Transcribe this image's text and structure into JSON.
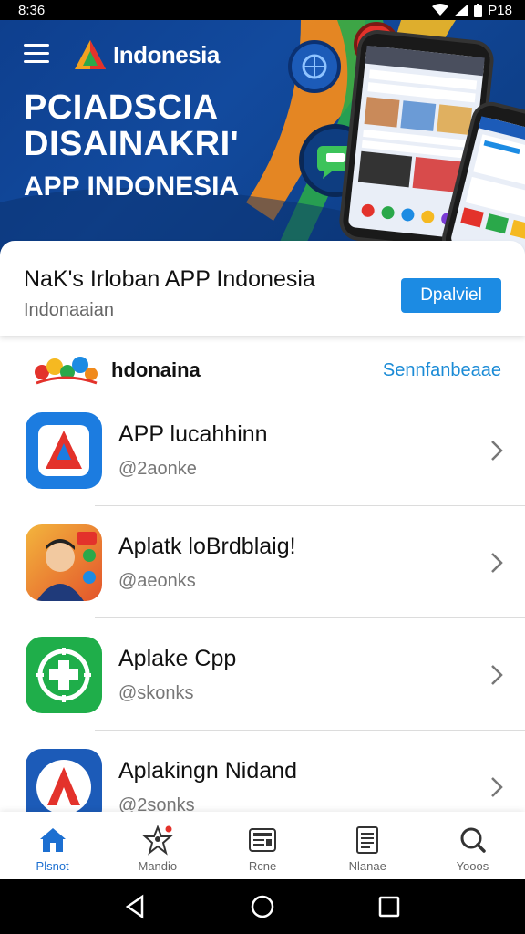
{
  "status_bar": {
    "time": "8:36",
    "battery": "P18"
  },
  "hero": {
    "brand_name": "Indonesia",
    "title_line1": "PCIADSCIA",
    "title_line2": "DISAINAKRI'",
    "subtitle": "APP INDONESIA"
  },
  "feature": {
    "title": "NaK's Irloban APP Indonesia",
    "subtitle": "Indonaaian",
    "button_label": "Dpalviel"
  },
  "section": {
    "title": "hdonaina",
    "link": "Sennfanbeaae"
  },
  "apps": [
    {
      "name": "APP lucahhinn",
      "handle": "@2aonke",
      "icon": "red-arrow-icon"
    },
    {
      "name": "Aplatk loBrdblaig!",
      "handle": "@aeonks",
      "icon": "person-photo-icon"
    },
    {
      "name": "Aplake Cpp",
      "handle": "@skonks",
      "icon": "green-cross-icon"
    },
    {
      "name": "Aplakingn Nidand",
      "handle": "@2sonks",
      "icon": "red-a-icon"
    }
  ],
  "bottom_nav": [
    {
      "label": "Plsnot",
      "icon": "home-icon"
    },
    {
      "label": "Mandio",
      "icon": "star-person-icon"
    },
    {
      "label": "Rcne",
      "icon": "news-icon"
    },
    {
      "label": "Nlanae",
      "icon": "document-icon"
    },
    {
      "label": "Yooos",
      "icon": "search-icon"
    }
  ],
  "colors": {
    "hero_bg": "#0e3f8e",
    "accent": "#1c8be3",
    "link": "#1b8bd6",
    "nav_active": "#1c6fd1"
  }
}
